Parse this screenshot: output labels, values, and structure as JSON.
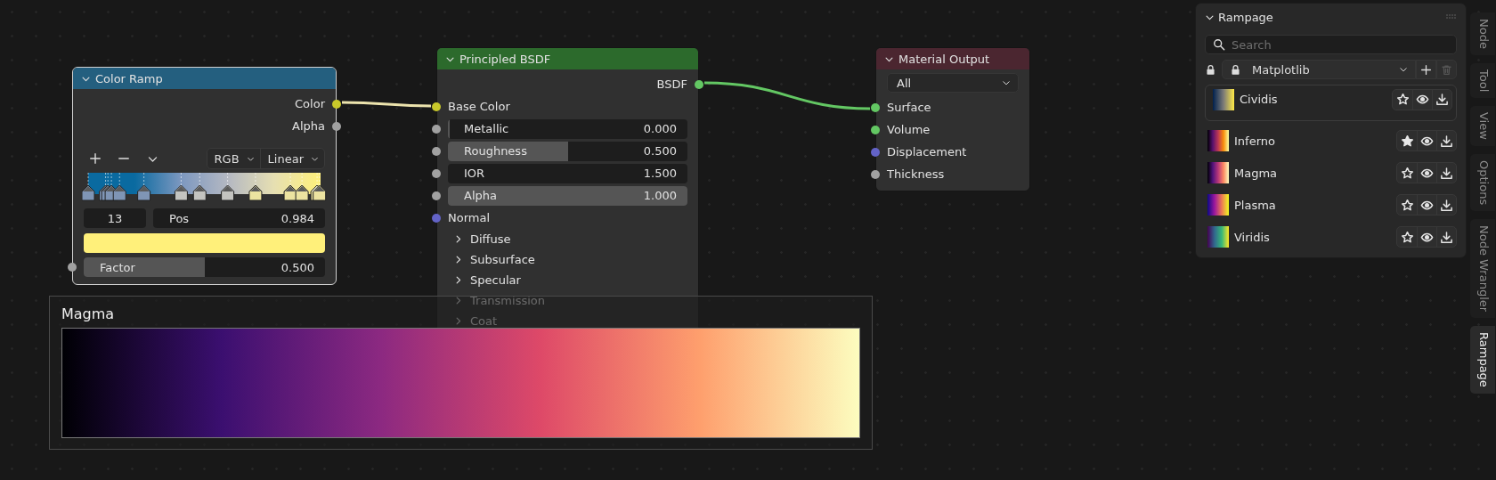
{
  "color_ramp_node": {
    "title": "Color Ramp",
    "selected": true,
    "expanded": true,
    "outputs": [
      {
        "label": "Color",
        "color": "#c8c82a"
      },
      {
        "label": "Alpha",
        "color": "#a1a1a1"
      }
    ],
    "color_mode": "RGB",
    "interpolation": "Linear",
    "active_stop": "13",
    "position_label": "Pos",
    "position_value": "0.984",
    "factor": {
      "label": "Factor",
      "value": "0.500",
      "level": 0.5,
      "color": "#a1a1a1"
    }
  },
  "principled_bsdf_node": {
    "title": "Principled BSDF",
    "selected": false,
    "expanded": true,
    "output": {
      "label": "BSDF",
      "color": "#63c763"
    },
    "inputs": [
      {
        "kind": "socket",
        "label": "Base Color",
        "color": "#c8c82a"
      },
      {
        "kind": "slider",
        "label": "Metallic",
        "value": "0.000",
        "level": 0,
        "color": "#a1a1a1"
      },
      {
        "kind": "slider",
        "label": "Roughness",
        "value": "0.500",
        "level": 0.5,
        "color": "#a1a1a1"
      },
      {
        "kind": "number",
        "label": "IOR",
        "value": "1.500",
        "color": "#a1a1a1"
      },
      {
        "kind": "slider",
        "label": "Alpha",
        "value": "1.000",
        "level": 1,
        "color": "#a1a1a1"
      },
      {
        "kind": "socket",
        "label": "Normal",
        "color": "#6363c7"
      },
      {
        "kind": "panel",
        "label": "Diffuse",
        "expanded": false
      },
      {
        "kind": "panel",
        "label": "Subsurface",
        "expanded": false
      },
      {
        "kind": "panel",
        "label": "Specular",
        "expanded": false
      },
      {
        "kind": "panel",
        "label": "Transmission",
        "expanded": false
      },
      {
        "kind": "panel",
        "label": "Coat",
        "expanded": false
      }
    ]
  },
  "material_output_node": {
    "title": "Material Output",
    "selected": false,
    "expanded": true,
    "target": "All",
    "inputs": [
      {
        "label": "Surface",
        "color": "#63c763"
      },
      {
        "label": "Volume",
        "color": "#63c763"
      },
      {
        "label": "Displacement",
        "color": "#6363c7"
      },
      {
        "label": "Thickness",
        "color": "#a1a1a1"
      }
    ]
  },
  "colormap_preview": {
    "title": "Magma"
  },
  "rampage_panel": {
    "title": "Rampage",
    "expanded": true,
    "search": {
      "placeholder": "Search"
    },
    "library": "Matplotlib",
    "items": [
      {
        "name": "Cividis",
        "selected": true,
        "favorite": false
      },
      {
        "name": "Inferno",
        "selected": false,
        "favorite": true
      },
      {
        "name": "Magma",
        "selected": false,
        "favorite": false
      },
      {
        "name": "Plasma",
        "selected": false,
        "favorite": false
      },
      {
        "name": "Viridis",
        "selected": false,
        "favorite": false
      }
    ]
  },
  "sidebar_tabs": [
    {
      "label": "Node",
      "selected": false
    },
    {
      "label": "Tool",
      "selected": false
    },
    {
      "label": "View",
      "selected": false
    },
    {
      "label": "Options",
      "selected": false
    },
    {
      "label": "Node Wrangler",
      "selected": false
    },
    {
      "label": "Rampage",
      "selected": true
    }
  ]
}
